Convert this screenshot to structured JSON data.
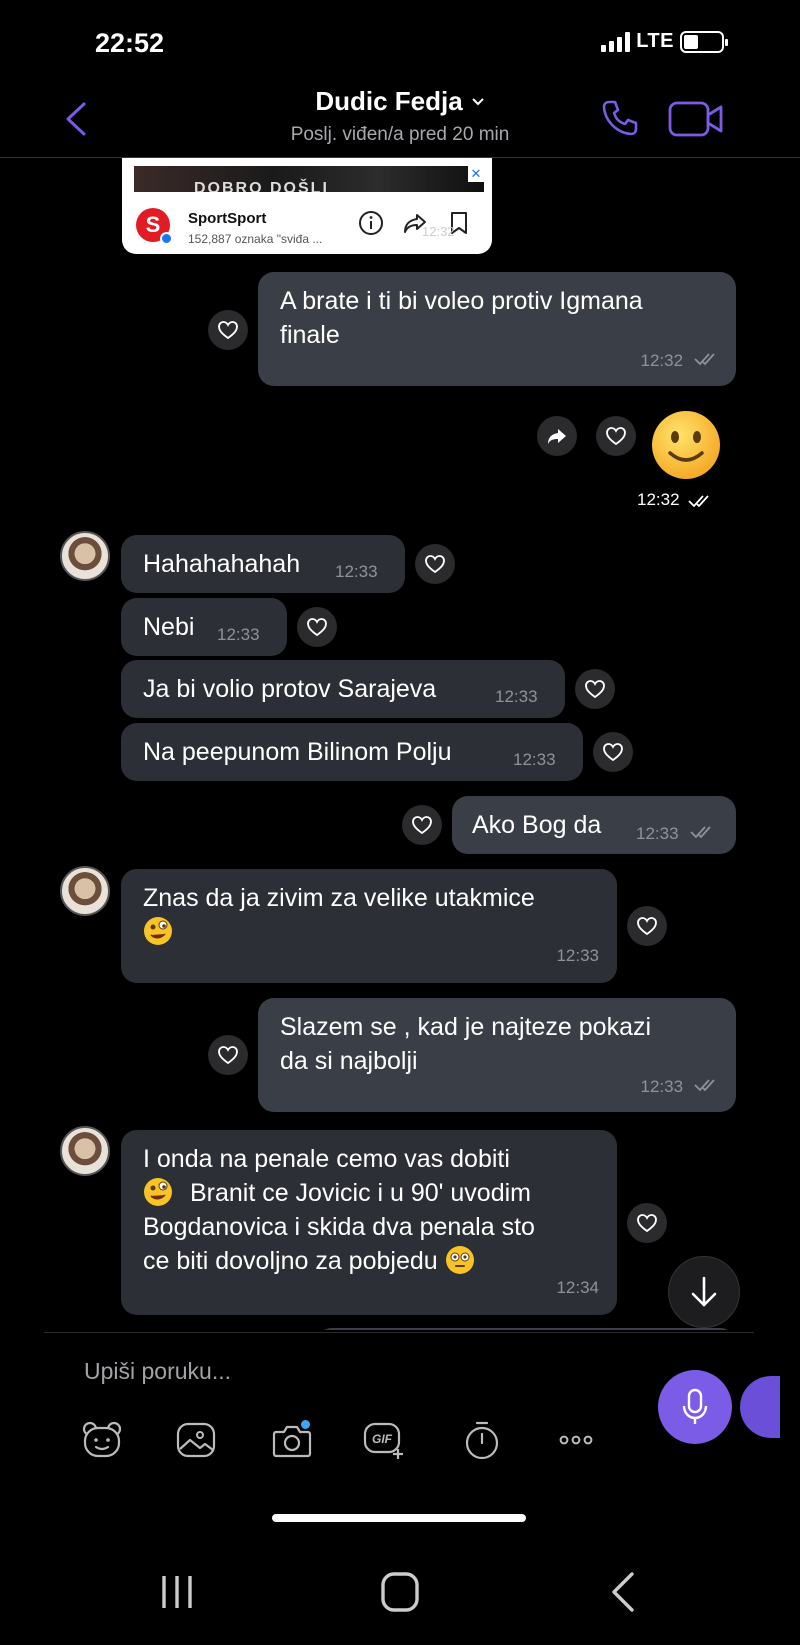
{
  "status_bar": {
    "time": "22:52",
    "network": "LTE"
  },
  "header": {
    "contact_name": "Dudic Fedja",
    "last_seen": "Poslj. viđen/a pred 20 min"
  },
  "ad": {
    "banner_text": "DOBRO DOŠLI",
    "page_name": "SportSport",
    "likes_text": "152,887 oznaka \"sviđa ...",
    "time": "12:32"
  },
  "messages": [
    {
      "side": "out",
      "text_line1": "A brate i ti bi voleo protiv Igmana",
      "text_line2": "finale",
      "time": "12:32"
    },
    {
      "side": "out",
      "type": "emoji",
      "emoji": "slightly-smiling-face",
      "time": "12:32"
    },
    {
      "side": "in",
      "text": "Hahahahahah",
      "time": "12:33"
    },
    {
      "side": "in",
      "text": "Nebi",
      "time": "12:33"
    },
    {
      "side": "in",
      "text": "Ja bi volio protov Sarajeva",
      "time": "12:33"
    },
    {
      "side": "in",
      "text": "Na peepunom Bilinom Polju",
      "time": "12:33"
    },
    {
      "side": "out",
      "text": "Ako Bog da",
      "time": "12:33"
    },
    {
      "side": "in",
      "text_line1": "Znas da ja zivim za velike utakmice",
      "emoji": "winking-zany-face",
      "time": "12:33"
    },
    {
      "side": "out",
      "text_line1": "Slazem se , kad je najteze pokazi",
      "text_line2": "da si najbolji",
      "time": "12:33"
    },
    {
      "side": "in",
      "text_line1": "I onda na penale cemo vas dobiti",
      "text_line2": "Branit ce Jovicic i u 90' uvodim",
      "text_line3": "Bogdanovica i skida dva penala sto",
      "text_line4": "ce biti dovoljno za pobjedu",
      "time": "12:34"
    }
  ],
  "composer": {
    "placeholder": "Upiši poruku...",
    "tools": [
      "sticker-icon",
      "gallery-icon",
      "camera-icon",
      "gif-icon",
      "timer-icon",
      "more-icon"
    ]
  },
  "colors": {
    "accent": "#7b5ce6",
    "bubble_in": "#2c2f36",
    "bubble_out": "#3a3f47",
    "background": "#000000"
  }
}
